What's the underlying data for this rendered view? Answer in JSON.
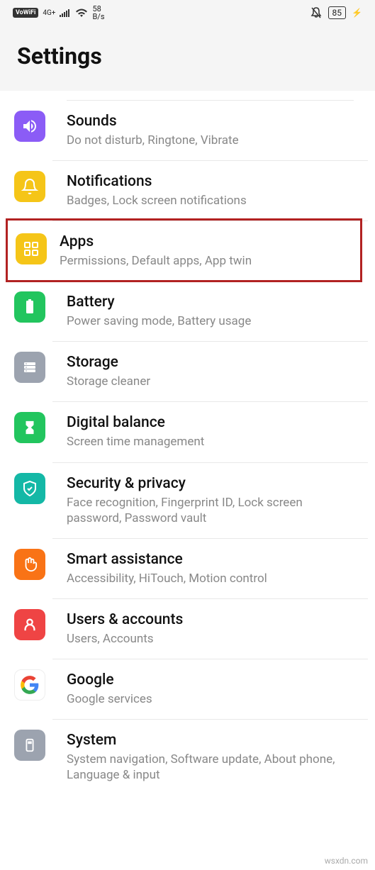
{
  "status": {
    "vowifi": "VoWiFi",
    "network": "4G+",
    "speed_value": "58",
    "speed_unit": "B/s",
    "battery": "85"
  },
  "header": {
    "title": "Settings"
  },
  "items": [
    {
      "id": "sounds",
      "title": "Sounds",
      "subtitle": "Do not disturb, Ringtone, Vibrate",
      "color": "#8b5cf6"
    },
    {
      "id": "notifications",
      "title": "Notifications",
      "subtitle": "Badges, Lock screen notifications",
      "color": "#f5c518"
    },
    {
      "id": "apps",
      "title": "Apps",
      "subtitle": "Permissions, Default apps, App twin",
      "color": "#f5c518",
      "highlighted": true
    },
    {
      "id": "battery",
      "title": "Battery",
      "subtitle": "Power saving mode, Battery usage",
      "color": "#22c55e"
    },
    {
      "id": "storage",
      "title": "Storage",
      "subtitle": "Storage cleaner",
      "color": "#9ca3af"
    },
    {
      "id": "digital-balance",
      "title": "Digital balance",
      "subtitle": "Screen time management",
      "color": "#22c55e"
    },
    {
      "id": "security-privacy",
      "title": "Security & privacy",
      "subtitle": "Face recognition, Fingerprint ID, Lock screen password, Password vault",
      "color": "#14b8a6"
    },
    {
      "id": "smart-assistance",
      "title": "Smart assistance",
      "subtitle": "Accessibility, HiTouch, Motion control",
      "color": "#f97316"
    },
    {
      "id": "users-accounts",
      "title": "Users & accounts",
      "subtitle": "Users, Accounts",
      "color": "#ef4444"
    },
    {
      "id": "google",
      "title": "Google",
      "subtitle": "Google services",
      "color": "#ffffff"
    },
    {
      "id": "system",
      "title": "System",
      "subtitle": "System navigation, Software update, About phone, Language & input",
      "color": "#9ca3af"
    }
  ],
  "watermark": "wsxdn.com"
}
